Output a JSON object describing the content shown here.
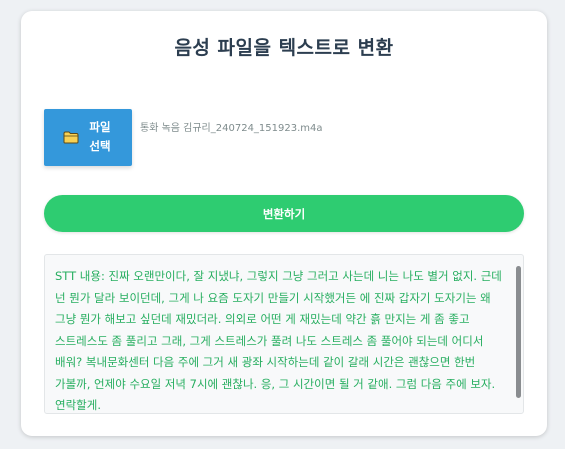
{
  "app": {
    "title": "음성 파일을 텍스트로 변환"
  },
  "upload": {
    "button_label": "파일 선택",
    "button_icon": "folder-icon",
    "selected_file": "통화 녹음 김규리_240724_151923.m4a"
  },
  "actions": {
    "convert_label": "변환하기"
  },
  "result": {
    "text": "STT 내용: 진짜 오랜만이다, 잘 지냈냐, 그렇지 그냥 그러고 사는데 니는 나도 별거 없지. 근데 넌 뭔가 달라 보이던데, 그게 나 요즘 도자기 만들기 시작했거든 에 진짜 갑자기 도자기는 왜 그냥 뭔가 해보고 싶던데 재밌더라. 의외로 어떤 게 재밌는데 약간 흙 만지는 게 좀 좋고 스트레스도 좀 풀리고 그래, 그게 스트레스가 풀려 나도 스트레스 좀 풀어야 되는데 어디서 배워? 복내문화센터 다음 주에 그거 새 광좌 시작하는데 같이 갈래 시간은 괜찮으면 한번 가볼까, 언제야 수요일 저녁 7시에 괜찮나. 응, 그 시간이면 될 거 같애. 그럼 다음 주에 보자. 연락할게."
  },
  "colors": {
    "title": "#2c3e50",
    "file_button": "#3498db",
    "convert_button": "#2ecc71",
    "result_text": "#27ae60",
    "background": "#eef1f4"
  }
}
